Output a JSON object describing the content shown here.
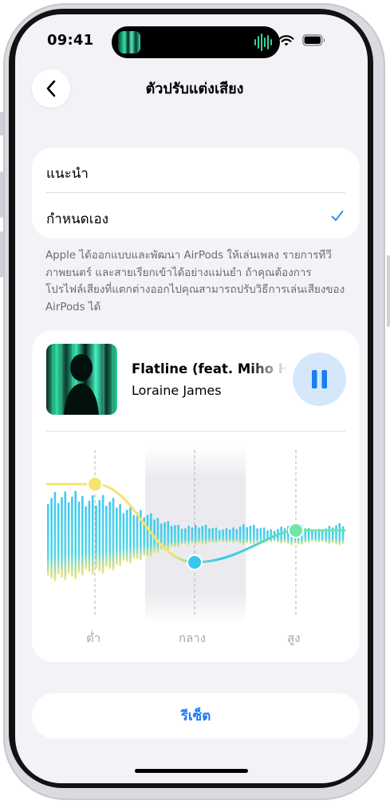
{
  "status": {
    "time": "09:41",
    "icons": [
      "wifi-icon",
      "battery-icon"
    ]
  },
  "nav": {
    "title": "ตัวปรับแต่งเสียง",
    "back_icon": "chevron-left-icon"
  },
  "options": [
    {
      "label": "แนะนำ",
      "selected": false
    },
    {
      "label": "กำหนดเอง",
      "selected": true
    }
  ],
  "description": "Apple ได้ออกแบบและพัฒนา AirPods ให้เล่นเพลง รายการทีวี ภาพยนตร์ และสายเรียกเข้าได้อย่างแม่นยำ ถ้าคุณต้องการโปรไฟล์เสียงที่แตกต่างออกไปคุณสามารถปรับวิธีการเล่นเสียงของ AirPods ได้",
  "now_playing": {
    "title": "Flatline (feat. Miho Ha",
    "artist": "Loraine James",
    "control_icon": "pause-icon"
  },
  "equalizer": {
    "labels": {
      "low": "ต่ำ",
      "mid": "กลาง",
      "high": "สูง"
    }
  },
  "reset_label": "รีเซ็ต",
  "colors": {
    "accent": "#1b7cf5",
    "background": "#f2f2f7",
    "eq_cyan": "#37c6ee",
    "eq_yellow": "#f4e36e",
    "eq_green": "#6fe8a6"
  }
}
